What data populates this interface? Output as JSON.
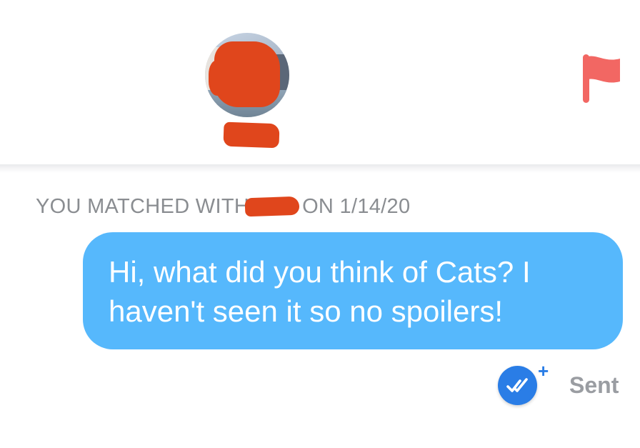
{
  "header": {
    "avatar_icon": "profile-avatar",
    "report_icon": "flag-icon",
    "report_color": "#f26763"
  },
  "match": {
    "prefix": "YOU MATCHED WITH",
    "suffix": "ON 1/14/20"
  },
  "message": {
    "text": "Hi, what did you think of Cats? I haven't seen it so no spoilers!",
    "bubble_color": "#56b8fc"
  },
  "status": {
    "read_icon": "double-check-icon",
    "plus_icon": "plus-icon",
    "plus_glyph": "+",
    "label": "Sent"
  }
}
